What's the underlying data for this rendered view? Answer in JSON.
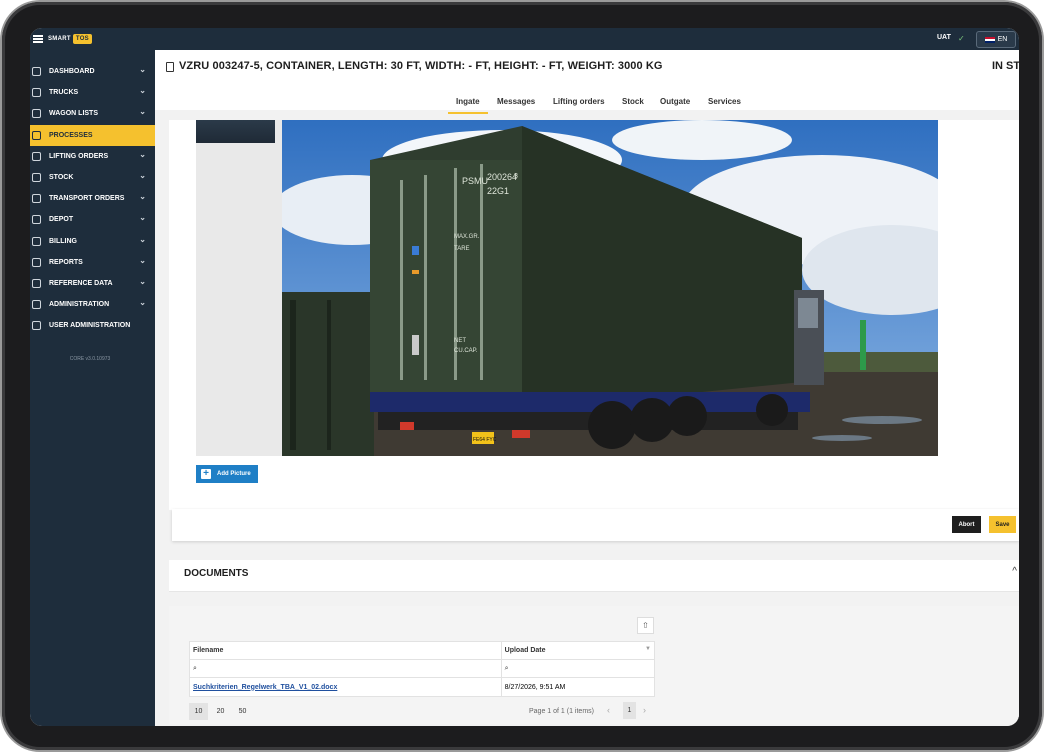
{
  "topbar": {
    "logo_text": "SMART",
    "logo_badge": "TOS",
    "environment": "UAT",
    "language": "EN"
  },
  "sidebar": {
    "items": [
      {
        "label": "DASHBOARD",
        "icon": "dashboard-icon",
        "has_children": true
      },
      {
        "label": "TRUCKS",
        "icon": "truck-icon",
        "has_children": true
      },
      {
        "label": "WAGON LISTS",
        "icon": "wagon-icon",
        "has_children": true
      },
      {
        "label": "PROCESSES",
        "icon": "processes-icon",
        "has_children": false,
        "active": true
      },
      {
        "label": "LIFTING ORDERS",
        "icon": "lifting-icon",
        "has_children": true
      },
      {
        "label": "STOCK",
        "icon": "stock-icon",
        "has_children": true
      },
      {
        "label": "TRANSPORT ORDERS",
        "icon": "transport-icon",
        "has_children": true
      },
      {
        "label": "DEPOT",
        "icon": "depot-icon",
        "has_children": true
      },
      {
        "label": "BILLING",
        "icon": "billing-icon",
        "has_children": true
      },
      {
        "label": "REPORTS",
        "icon": "reports-icon",
        "has_children": true
      },
      {
        "label": "REFERENCE DATA",
        "icon": "database-icon",
        "has_children": true
      },
      {
        "label": "ADMINISTRATION",
        "icon": "gear-icon",
        "has_children": true
      },
      {
        "label": "USER ADMINISTRATION",
        "icon": "user-icon",
        "has_children": false
      }
    ],
    "version": "CORE v3.0.10973"
  },
  "header": {
    "title": "VZRU 003247-5, CONTAINER, LENGTH: 30 FT, WIDTH: - FT, HEIGHT: - FT, WEIGHT: 3000 KG",
    "status": "IN STO"
  },
  "tabs": [
    {
      "label": "Ingate",
      "active": true
    },
    {
      "label": "Messages"
    },
    {
      "label": "Lifting orders"
    },
    {
      "label": "Stock"
    },
    {
      "label": "Outgate"
    },
    {
      "label": "Services"
    }
  ],
  "pictures": {
    "add_label": "Add Picture",
    "container_text": [
      "PSMU",
      "200264",
      "3",
      "22G1",
      "MAX.GR.",
      "TARE",
      "NET",
      "CU.CAP."
    ],
    "plate": "FE64 FYC"
  },
  "actions": {
    "abort": "Abort",
    "save": "Save"
  },
  "documents": {
    "title": "DOCUMENTS",
    "columns": [
      "Filename",
      "Upload Date"
    ],
    "rows": [
      {
        "filename": "Suchkriterien_Regelwerk_TBA_V1_02.docx",
        "upload_date": "8/27/2026, 9:51 AM"
      }
    ],
    "page_sizes": [
      "10",
      "20",
      "50"
    ],
    "selected_page_size": "10",
    "page_info": "Page 1 of 1 (1 items)",
    "current_page": "1"
  },
  "colors": {
    "sidebar_bg": "#1e2d3c",
    "accent": "#f5c12e",
    "primary_button": "#1f7fc6"
  }
}
